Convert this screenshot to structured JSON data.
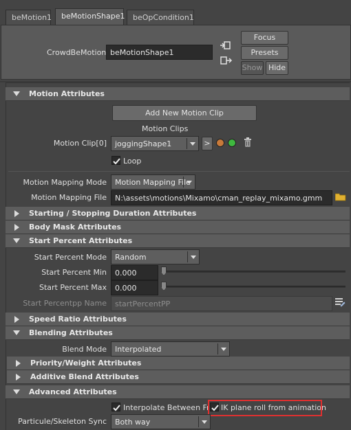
{
  "tabs": [
    "beMotion1",
    "beMotionShape1",
    "beOpCondition1"
  ],
  "header": {
    "node_label": "CrowdBeMotion:",
    "node_value": "beMotionShape1",
    "buttons": {
      "focus": "Focus",
      "presets": "Presets",
      "show": "Show",
      "hide": "Hide"
    }
  },
  "motion_attributes": {
    "title": "Motion Attributes",
    "add_clip_button": "Add New Motion Clip",
    "clips_label": "Motion Clips",
    "clip_label": "Motion Clip[0]",
    "clip_value": "joggingShape1",
    "go_button": ">",
    "loop_label": "Loop",
    "mapping_mode_label": "Motion Mapping Mode",
    "mapping_mode_value": "Motion Mapping File",
    "mapping_file_label": "Motion Mapping File",
    "mapping_file_value": "N:\\assets\\motions\\Mixamo\\cman_replay_mixamo.gmm"
  },
  "sections": {
    "starting_stopping": "Starting / Stopping Duration Attributes",
    "body_mask": "Body Mask Attributes",
    "start_percent": "Start Percent Attributes",
    "speed_ratio": "Speed Ratio Attributes",
    "blending": "Blending Attributes",
    "priority_weight": "Priority/Weight Attributes",
    "additive_blend": "Additive Blend Attributes",
    "advanced": "Advanced Attributes"
  },
  "start_percent": {
    "mode_label": "Start Percent Mode",
    "mode_value": "Random",
    "min_label": "Start Percent Min",
    "min_value": "0.000",
    "max_label": "Start Percent Max",
    "max_value": "0.000",
    "pp_label": "Start Percentpp Name",
    "pp_value": "startPercentPP"
  },
  "blending": {
    "blend_mode_label": "Blend Mode",
    "blend_mode_value": "Interpolated"
  },
  "advanced": {
    "interpolate_label": "Interpolate Between Fran",
    "ik_label": "IK plane roll from animation",
    "sync_label": "Particule/Skeleton Sync",
    "sync_value": "Both way"
  },
  "colors": {
    "highlight": "#e03030",
    "orange_dot": "#c87a3a",
    "green_dot": "#3fb83f"
  }
}
